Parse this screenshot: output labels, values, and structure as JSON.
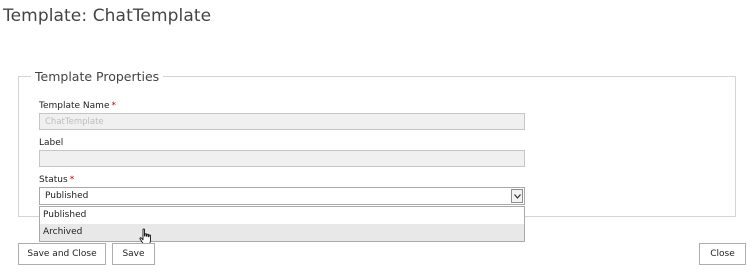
{
  "page": {
    "title": "Template: ChatTemplate"
  },
  "properties": {
    "legend": "Template Properties",
    "template_name": {
      "label": "Template Name",
      "required_mark": "*",
      "placeholder": "ChatTemplate",
      "value": ""
    },
    "label_field": {
      "label": "Label",
      "value": ""
    },
    "status": {
      "label": "Status",
      "required_mark": "*",
      "selected": "Published",
      "options": [
        "Published",
        "Archived"
      ],
      "hovered_option": "Archived"
    }
  },
  "buttons": {
    "save_and_close": "Save and Close",
    "save": "Save",
    "close": "Close"
  },
  "icons": {
    "dropdown_arrow": "chevron-down-icon",
    "cursor": "hand-pointer-icon"
  }
}
